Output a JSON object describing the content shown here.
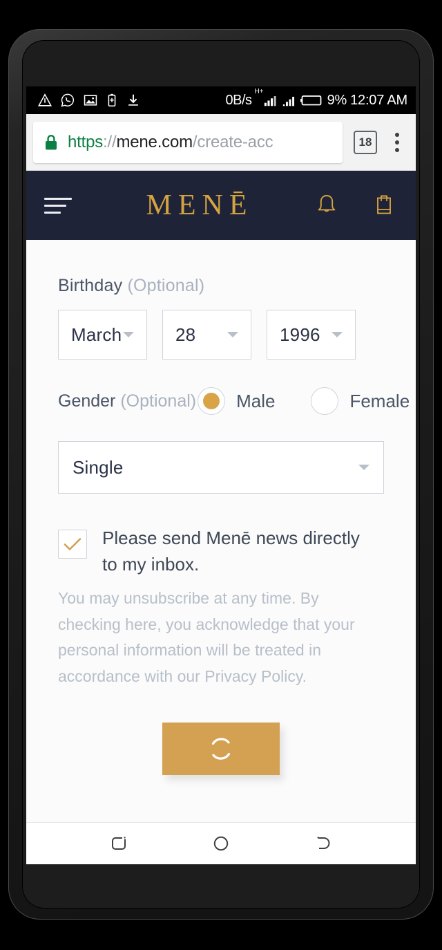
{
  "status_bar": {
    "icons": [
      "triangle-alert-icon",
      "whatsapp-icon",
      "screenshot-icon",
      "battery-saver-icon",
      "download-icon"
    ],
    "network_speed": "0B/s",
    "network_type": "H+",
    "battery_percent": "9%",
    "time": "12:07 AM"
  },
  "browser": {
    "url_scheme": "https",
    "url_sep": "://",
    "url_host": "mene.com",
    "url_path": "/create-acc",
    "tab_count": "18",
    "lock_icon": "lock-icon",
    "menu_icon": "kebab-menu-icon"
  },
  "site_header": {
    "brand": "MENĒ",
    "menu_icon": "hamburger-icon",
    "bell_icon": "bell-icon",
    "bag_icon": "shopping-bag-icon",
    "bg_color": "#1e2338",
    "gold": "#d5a33f"
  },
  "form": {
    "birthday_label": "Birthday",
    "birthday_optional": "(Optional)",
    "birthday": {
      "month": "March",
      "day": "28",
      "year": "1996"
    },
    "gender_label": "Gender",
    "gender_optional": "(Optional)",
    "gender_options": [
      {
        "label": "Male",
        "selected": true
      },
      {
        "label": "Female",
        "selected": false
      }
    ],
    "relationship_status": "Single",
    "newsletter": {
      "checked": true,
      "label": "Please send Menē news directly to my inbox.",
      "fineprint": "You may unsubscribe at any time. By checking here, you acknowledge that your personal information will be treated in accordance with our Privacy Policy."
    },
    "submit": {
      "state": "loading",
      "icon": "spinner-icon",
      "color": "#d4a052"
    }
  },
  "nav_bar": {
    "recent_icon": "recent-apps-icon",
    "home_icon": "home-icon",
    "back_icon": "back-icon"
  }
}
